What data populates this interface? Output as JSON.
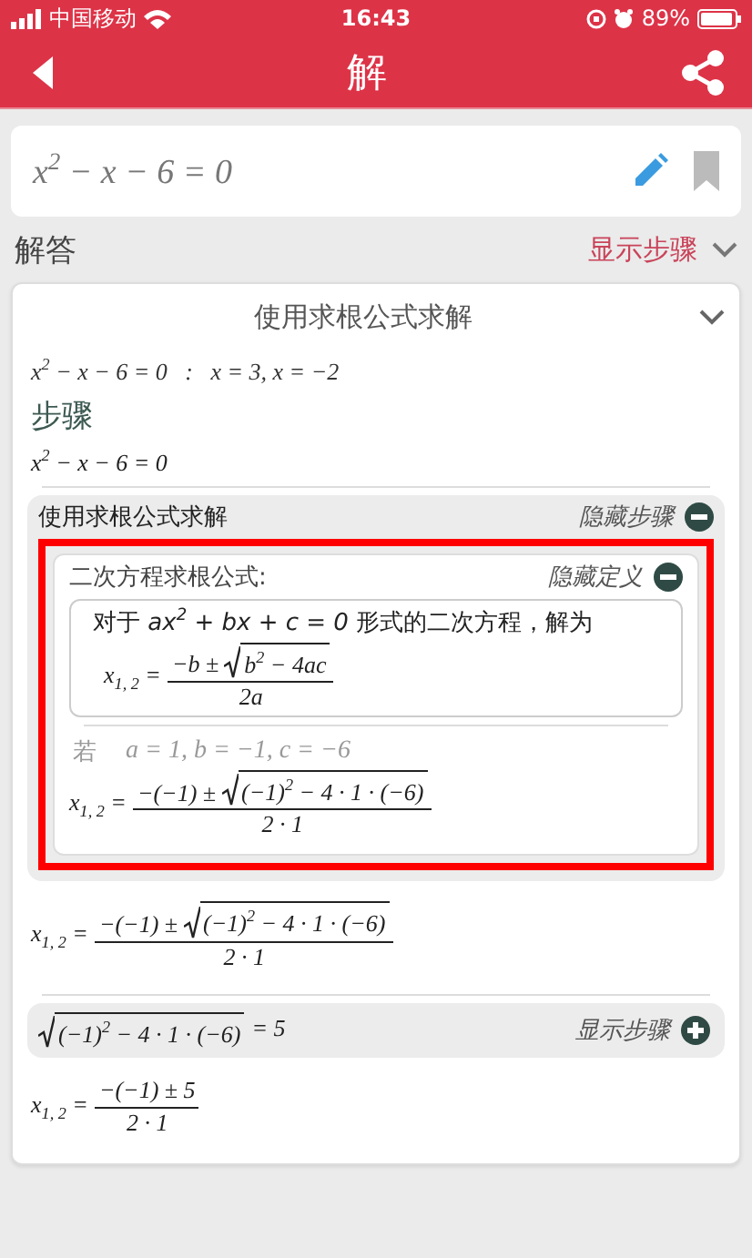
{
  "status_bar": {
    "carrier": "中国移动",
    "time": "16:43",
    "battery": "89%"
  },
  "header": {
    "title": "解"
  },
  "input": {
    "value": "x$^{2}$ − x − 6 = 0"
  },
  "answer_bar": {
    "label": "解答",
    "toggle": "显示步骤",
    "expanded": false
  },
  "solution": {
    "title": "使用求根公式求解",
    "expanded": true,
    "result": "x$^{2}$ − x − 6 = 0   :   x = 3, x = −2",
    "steps_heading": "步骤",
    "equation": "x$^{2}$ − x − 6 = 0",
    "step": {
      "title": "使用求根公式求解",
      "toggle": "隐藏步骤",
      "expanded": true,
      "definition": {
        "title": "二次方程求根公式:",
        "toggle": "隐藏定义",
        "expanded": true,
        "highlighted": true,
        "sentence": "对于 *ax$^{2}$ + bx + c = 0* 形式的二次方程，解为",
        "formula": [
          {
            "kind": "text",
            "text": "x$_{1, 2}$ ="
          },
          {
            "kind": "frac",
            "num": [
              {
                "kind": "text",
                "text": "−b ±"
              },
              {
                "kind": "sqrt",
                "text": "b$^{2}$ − 4ac"
              }
            ],
            "den": "2a"
          }
        ]
      },
      "given": "若",
      "given_values": "a = 1, b = −1, c = −6",
      "formula": [
        {
          "kind": "text",
          "text": "x$_{1, 2}$ ="
        },
        {
          "kind": "frac",
          "num": [
            {
              "kind": "text",
              "text": "−(−1) ±"
            },
            {
              "kind": "sqrt",
              "text": "(−1)$^{2}$ − 4 · 1 · (−6)"
            }
          ],
          "den": "2 · 1"
        }
      ]
    },
    "after": [
      {
        "kind": "formula",
        "parts": [
          {
            "kind": "text",
            "text": "x$_{1, 2}$ ="
          },
          {
            "kind": "frac",
            "num": [
              {
                "kind": "text",
                "text": "−(−1) ±"
              },
              {
                "kind": "sqrt",
                "text": "(−1)$^{2}$ − 4 · 1 · (−6)"
              }
            ],
            "den": "2 · 1"
          }
        ]
      },
      {
        "kind": "substep",
        "toggle": "显示步骤",
        "expanded": false,
        "parts": [
          {
            "kind": "sqrt",
            "text": "(−1)$^{2}$ − 4 · 1 · (−6)"
          },
          {
            "kind": "text",
            "text": "= 5"
          }
        ]
      },
      {
        "kind": "formula",
        "parts": [
          {
            "kind": "text",
            "text": "x$_{1, 2}$ ="
          },
          {
            "kind": "frac",
            "num": [
              {
                "kind": "text",
                "text": "−(−1) ± 5"
              }
            ],
            "den": "2 · 1"
          }
        ]
      }
    ]
  }
}
